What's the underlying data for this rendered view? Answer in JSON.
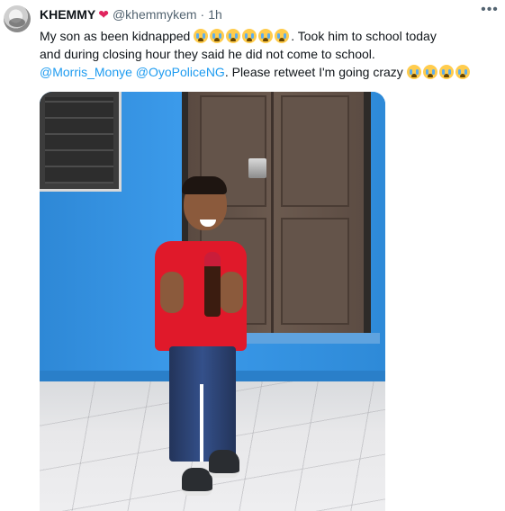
{
  "tweet": {
    "display_name": "KHEMMY",
    "heart_emoji": "❤",
    "handle": "@khemmykem",
    "separator": "·",
    "time": "1h",
    "more_icon": "more-horizontal-icon",
    "line1": "My son as been kidnapped",
    "line1_tail": ". Took him to school today",
    "line2": "and during closing hour they said he did not come to school.",
    "mention1": "@Morris_Monye",
    "mention2": "@OyoPoliceNG",
    "line3_tail": ". Please retweet I'm going crazy",
    "emoji_name": "loudly-crying-face-emoji",
    "emoji_count_line1": 6,
    "emoji_count_line3": 4
  },
  "colors": {
    "text": "#0f1419",
    "secondary": "#536471",
    "link": "#1d9bf0",
    "heart": "#e0245e"
  },
  "media": {
    "description_icon": "photo-child-red-shirt"
  }
}
